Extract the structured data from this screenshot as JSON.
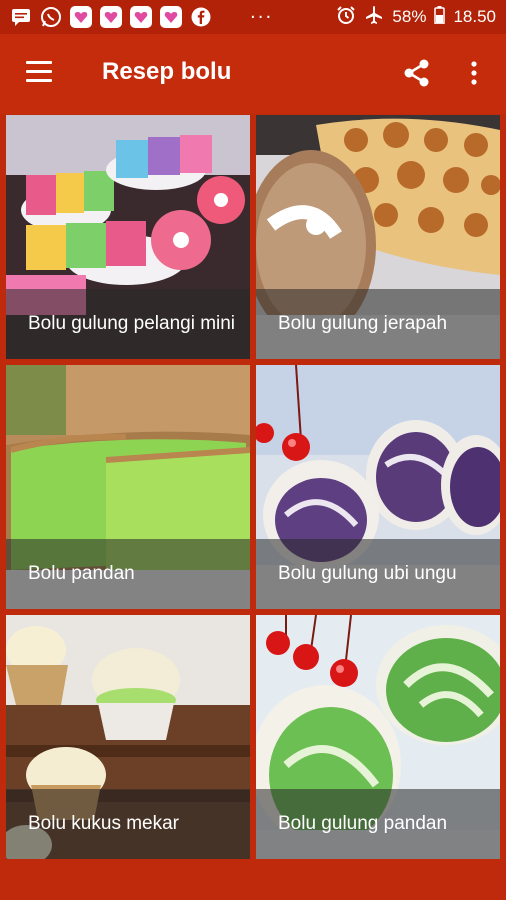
{
  "status_bar": {
    "icons": [
      "message-icon",
      "whatsapp-icon",
      "app-icon",
      "app-icon",
      "app-icon",
      "app-icon",
      "facebook-icon"
    ],
    "overflow": "···",
    "right_icons": [
      "alarm-icon",
      "airplane-icon"
    ],
    "battery": "58%",
    "time": "18.50"
  },
  "toolbar": {
    "title": "Resep bolu",
    "background": "#c52c0c"
  },
  "recipes": [
    {
      "label": "Bolu gulung pelangi mini"
    },
    {
      "label": "Bolu gulung jerapah"
    },
    {
      "label": "Bolu pandan"
    },
    {
      "label": "Bolu gulung ubi ungu"
    },
    {
      "label": "Bolu kukus mekar"
    },
    {
      "label": "Bolu gulung pandan"
    }
  ],
  "colors": {
    "accent": "#bf2a0c",
    "caption_overlay": "rgba(40,40,40,0.55)"
  }
}
